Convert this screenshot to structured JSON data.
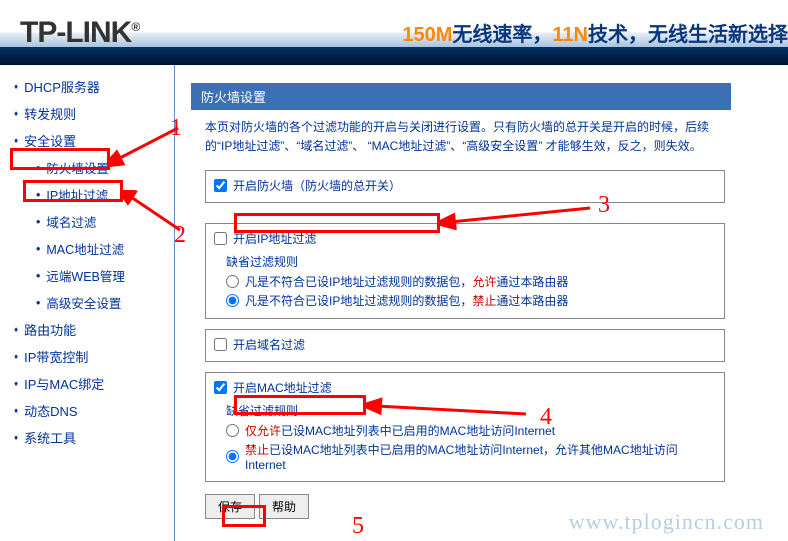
{
  "header": {
    "logo": "TP-LINK",
    "reg": "®",
    "tag_htm": "<span class='orange'>150M</span>无线速率，<span class='orange'>11N</span>技术，无线生活新选择"
  },
  "sidebar": {
    "items": [
      {
        "label": "DHCP服务器",
        "type": "parent"
      },
      {
        "label": "转发规则",
        "type": "parent"
      },
      {
        "label": "安全设置",
        "type": "parent"
      },
      {
        "label": "防火墙设置",
        "type": "sub"
      },
      {
        "label": "IP地址过滤",
        "type": "sub"
      },
      {
        "label": "域名过滤",
        "type": "sub"
      },
      {
        "label": "MAC地址过滤",
        "type": "sub"
      },
      {
        "label": "远端WEB管理",
        "type": "sub"
      },
      {
        "label": "高级安全设置",
        "type": "sub"
      },
      {
        "label": "路由功能",
        "type": "parent"
      },
      {
        "label": "IP带宽控制",
        "type": "parent"
      },
      {
        "label": "IP与MAC绑定",
        "type": "parent"
      },
      {
        "label": "动态DNS",
        "type": "parent"
      },
      {
        "label": "系统工具",
        "type": "parent"
      }
    ]
  },
  "panel": {
    "title": "防火墙设置",
    "desc": "本页对防火墙的各个过滤功能的开启与关闭进行设置。只有防火墙的总开关是开启的时候，后续的“IP地址过滤”、“域名过滤”、 “MAC地址过滤”、“高级安全设置” 才能够生效，反之，则失效。",
    "firewall_master": "开启防火墙（防火墙的总开关）",
    "ip_block": {
      "cb": "开启IP地址过滤",
      "rule_title": "缺省过滤规则",
      "r1_pre": "凡是不符合已设IP地址过滤规则的数据包，",
      "r1_hl": "允许",
      "r1_post": "通过本路由器",
      "r2_pre": "凡是不符合已设IP地址过滤规则的数据包，",
      "r2_hl": "禁止",
      "r2_post": "通过本路由器"
    },
    "domain_block": {
      "cb": "开启域名过滤"
    },
    "mac_block": {
      "cb": "开启MAC地址过滤",
      "rule_title": "缺省过滤规则",
      "r1_hl": "仅允许",
      "r1_post": "已设MAC地址列表中已启用的MAC地址访问Internet",
      "r2_hl": "禁止",
      "r2_mid": "已设MAC地址列表中已启用的MAC地址访问Internet，允许其他MAC地址访问Internet"
    },
    "save": "保存",
    "help": "帮助"
  },
  "watermark": "www.tplogincn.com",
  "annotations": [
    "1",
    "2",
    "3",
    "4",
    "5"
  ]
}
